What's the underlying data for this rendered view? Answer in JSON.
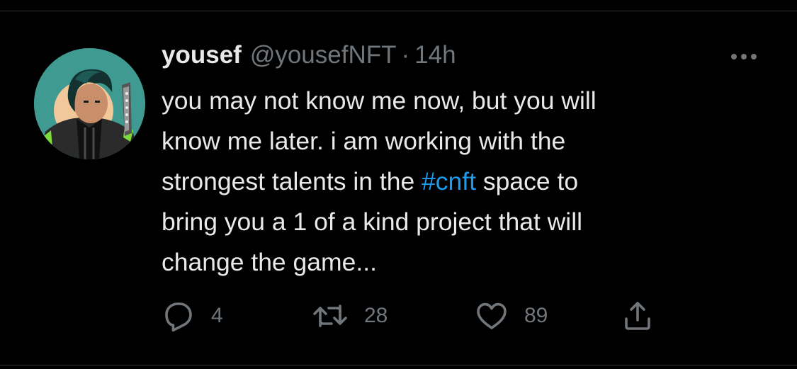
{
  "tweet": {
    "author": {
      "display_name": "yousef",
      "handle": "@yousefNFT",
      "separator": "·",
      "time": "14h"
    },
    "text_lines": [
      {
        "before": "you may not know me now, but you will",
        "hashtag": "",
        "after": ""
      },
      {
        "before": "know me later. i am working with the",
        "hashtag": "",
        "after": ""
      },
      {
        "before": "strongest talents in the ",
        "hashtag": "#cnft",
        "after": " space to"
      },
      {
        "before": "bring you a 1 of a kind project that will",
        "hashtag": "",
        "after": ""
      },
      {
        "before": "change the game...",
        "hashtag": "",
        "after": ""
      }
    ],
    "actions": {
      "reply_count": "4",
      "retweet_count": "28",
      "like_count": "89"
    }
  },
  "colors": {
    "background": "#000000",
    "text": "#e7e9ea",
    "secondary_text": "#71767b",
    "link": "#1d9bf0",
    "divider": "#2f3336"
  },
  "icons": {
    "more": "more-horizontal-icon",
    "reply": "reply-icon",
    "retweet": "retweet-icon",
    "like": "heart-icon",
    "share": "share-icon"
  }
}
